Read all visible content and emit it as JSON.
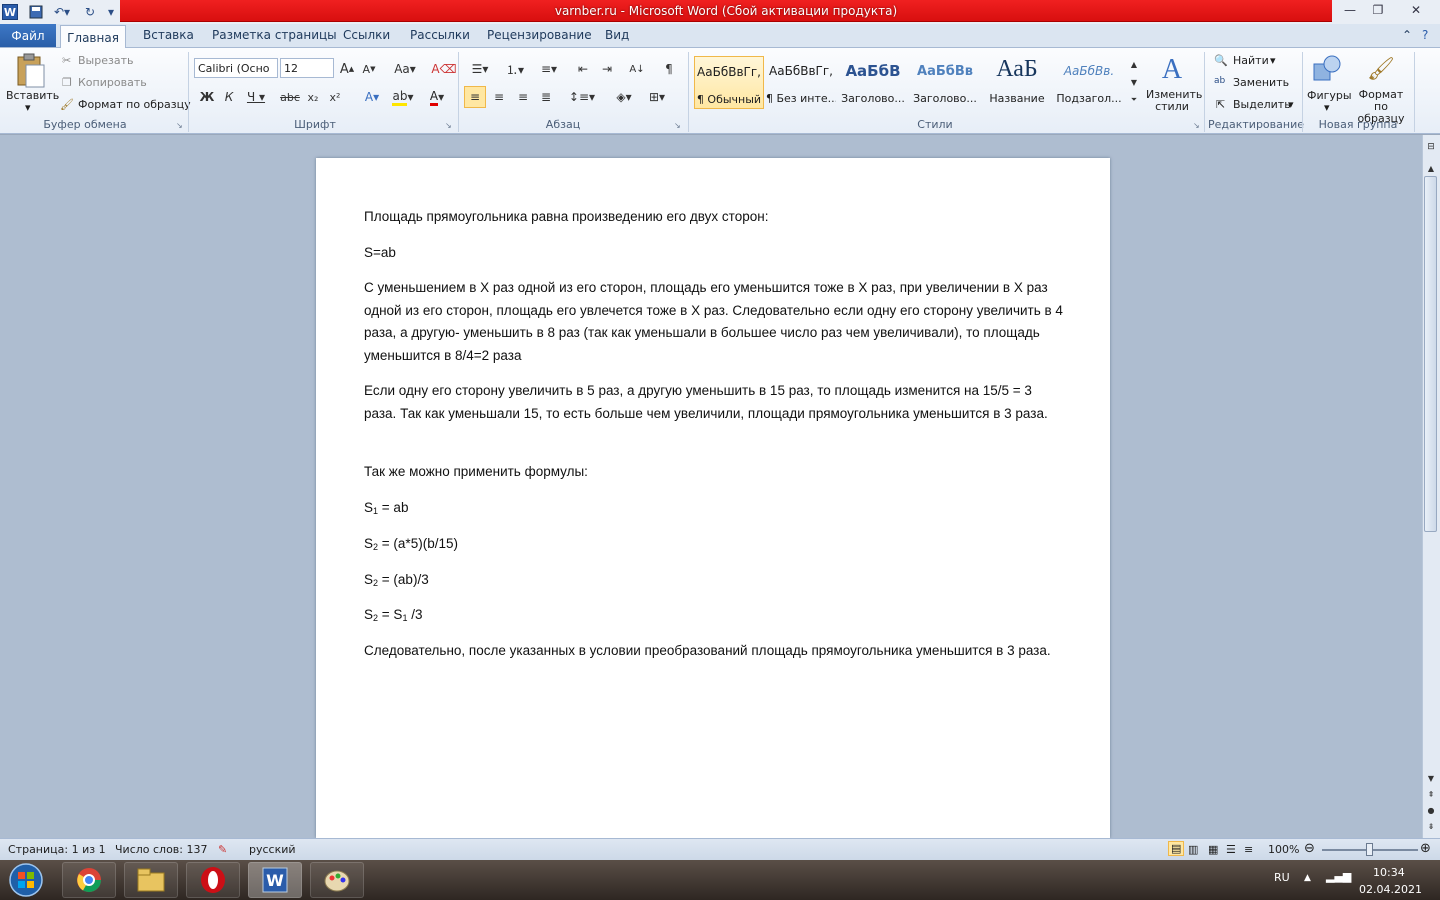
{
  "window": {
    "title": "varnber.ru  -  Microsoft Word (Сбой активации продукта)"
  },
  "tabs": {
    "file": "Файл",
    "items": [
      "Главная",
      "Вставка",
      "Разметка страницы",
      "Ссылки",
      "Рассылки",
      "Рецензирование",
      "Вид"
    ]
  },
  "ribbon": {
    "clipboard": {
      "paste": "Вставить",
      "cut": "Вырезать",
      "copy": "Копировать",
      "format_painter": "Формат по образцу",
      "label": "Буфер обмена"
    },
    "font": {
      "name": "Calibri (Осно",
      "size": "12",
      "label": "Шрифт"
    },
    "paragraph": {
      "label": "Абзац"
    },
    "styles": {
      "items": [
        {
          "preview": "АаБбВвГг,",
          "name": "¶ Обычный"
        },
        {
          "preview": "АаБбВвГг,",
          "name": "¶ Без инте..."
        },
        {
          "preview": "АаБбВ",
          "name": "Заголово..."
        },
        {
          "preview": "АаБбВв",
          "name": "Заголово..."
        },
        {
          "preview": "АаБ",
          "name": "Название"
        },
        {
          "preview": "АаБбВв.",
          "name": "Подзагол..."
        }
      ],
      "change_styles": "Изменить стили",
      "label": "Стили"
    },
    "editing": {
      "find": "Найти",
      "replace": "Заменить",
      "select": "Выделить",
      "label": "Редактирование"
    },
    "new_group": {
      "shapes": "Фигуры",
      "format_painter": "Формат по образцу",
      "label": "Новая группа"
    }
  },
  "document": {
    "p1": "Площадь прямоугольника равна произведению его двух сторон:",
    "p2": "S=ab",
    "p3": "С уменьшением в X раз одной из его сторон,  площадь его уменьшится  тоже в X раз, при увеличении в X раз одной из его сторон,  площадь его увлечется  тоже  в X раз. Следовательно если одну его сторону увеличить в 4 раза, а другую- уменьшить в 8 раз (так как уменьшали в большее число раз чем увеличивали), то площадь уменьшится в 8/4=2 раза",
    "p4": "Если одну его сторону увеличить в 5 раз, а другую уменьшить в 15 раз, то площадь изменится на 15/5 = 3 раза. Так как уменьшали 15, то есть больше чем увеличили, площади прямоугольника уменьшится в 3 раза.",
    "p5": "Так же можно применить формулы:",
    "f1": "= ab",
    "f2": "= (a*5)(b/15)",
    "f3": "= (ab)/3",
    "f4a": "=  S",
    "f4b": " /3",
    "s": "S",
    "sub1": "1",
    "sub2": "2",
    "p6": "Следовательно, после указанных в условии преобразований площадь прямоугольника уменьшится в 3 раза."
  },
  "statusbar": {
    "page": "Страница: 1 из 1",
    "words": "Число слов: 137",
    "language": "русский",
    "zoom": "100%"
  },
  "taskbar": {
    "lang": "RU",
    "time": "10:34",
    "date": "02.04.2021"
  }
}
